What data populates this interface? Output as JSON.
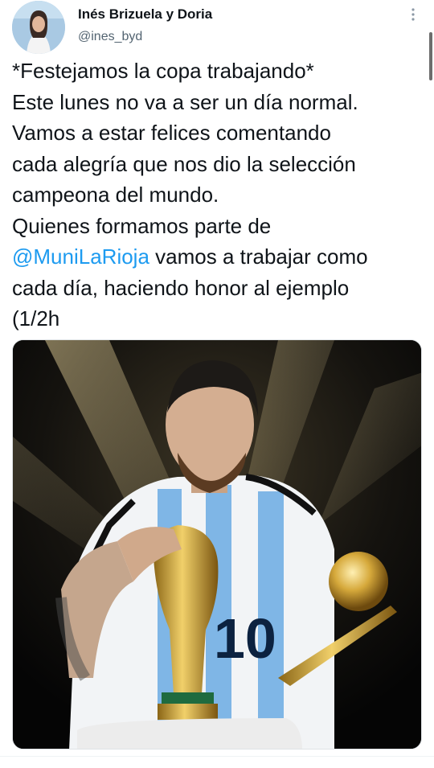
{
  "tweet": {
    "author_name": "Inés Brizuela y Doria",
    "author_handle": "@ines_byd",
    "more_icon": "more-vertical-icon",
    "lines": [
      {
        "text": "*Festejamos la copa trabajando*"
      },
      {
        "text": "Este lunes no va a ser un día normal."
      },
      {
        "text": "Vamos a estar felices comentando"
      },
      {
        "text": "cada alegría que nos dio la selección"
      },
      {
        "text": "campeona del mundo."
      },
      {
        "text": "Quienes formamos parte de"
      },
      {
        "mention": "@MuniLaRioja",
        "text": " vamos a trabajar como"
      },
      {
        "text": "cada día, haciendo honor al ejemplo"
      },
      {
        "text": "(1/2h"
      }
    ],
    "colors": {
      "text": "#0f1419",
      "secondary": "#536471",
      "link": "#1d9bf0"
    }
  }
}
